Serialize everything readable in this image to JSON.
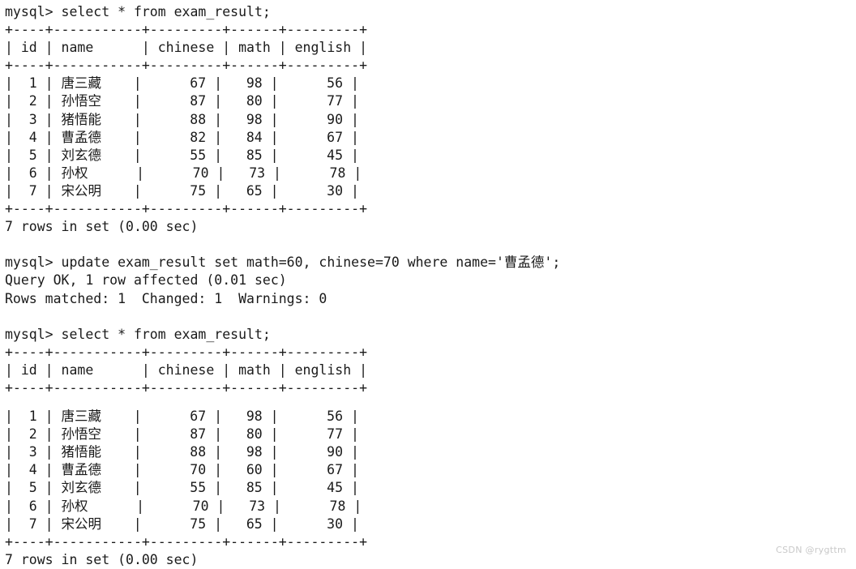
{
  "terminal": {
    "prompt": "mysql> ",
    "background_color": "#ffffff",
    "text_color": "#1a1a1a",
    "blocks": [
      {
        "type": "command",
        "text": "mysql> select * from exam_result;"
      },
      {
        "type": "table",
        "separator": "+----+-----------+---------+------+---------+",
        "header": "| id | name      | chinese | math | english |",
        "rows": [
          "|  1 | 唐三藏    |      67 |   98 |      56 |",
          "|  2 | 孙悟空    |      87 |   80 |      77 |",
          "|  3 | 猪悟能    |      88 |   98 |      90 |",
          "|  4 | 曹孟德    |      82 |   84 |      67 |",
          "|  5 | 刘玄德    |      55 |   85 |      45 |",
          "|  6 | 孙权      |      70 |   73 |      78 |",
          "|  7 | 宋公明    |      75 |   65 |      30 |"
        ],
        "footer": "7 rows in set (0.00 sec)"
      },
      {
        "type": "command",
        "text": "mysql> update exam_result set math=60, chinese=70 where name='曹孟德';"
      },
      {
        "type": "status",
        "lines": [
          "Query OK, 1 row affected (0.01 sec)",
          "Rows matched: 1  Changed: 1  Warnings: 0"
        ]
      },
      {
        "type": "command",
        "text": "mysql> select * from exam_result;"
      },
      {
        "type": "table",
        "separator": "+----+-----------+---------+------+---------+",
        "header": "| id | name      | chinese | math | english |",
        "rows": [
          "|  1 | 唐三藏    |      67 |   98 |      56 |",
          "|  2 | 孙悟空    |      87 |   80 |      77 |",
          "|  3 | 猪悟能    |      88 |   98 |      90 |",
          "|  4 | 曹孟德    |      70 |   60 |      67 |",
          "|  5 | 刘玄德    |      55 |   85 |      45 |",
          "|  6 | 孙权      |      70 |   73 |      78 |",
          "|  7 | 宋公明    |      75 |   65 |      30 |"
        ],
        "footer": "7 rows in set (0.00 sec)"
      }
    ],
    "table_columns": [
      "id",
      "name",
      "chinese",
      "math",
      "english"
    ]
  },
  "watermark": {
    "text": "CSDN @rygttm"
  }
}
